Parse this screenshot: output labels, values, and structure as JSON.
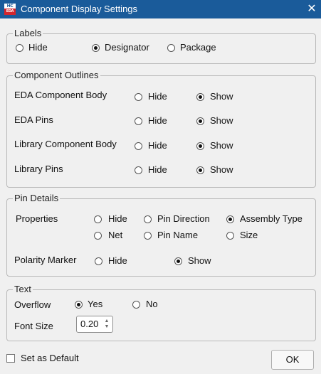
{
  "window": {
    "title": "Component Display Settings",
    "icon_top": "HC",
    "icon_bottom": "EDA",
    "close_glyph": "✕"
  },
  "labels": {
    "legend": "Labels",
    "options": [
      "Hide",
      "Designator",
      "Package"
    ],
    "selected": "Designator"
  },
  "outlines": {
    "legend": "Component Outlines",
    "rows": [
      {
        "label": "EDA Component Body",
        "hide": "Hide",
        "show": "Show",
        "selected": "Show"
      },
      {
        "label": "EDA Pins",
        "hide": "Hide",
        "show": "Show",
        "selected": "Show"
      },
      {
        "label": "Library Component Body",
        "hide": "Hide",
        "show": "Show",
        "selected": "Show"
      },
      {
        "label": "Library Pins",
        "hide": "Hide",
        "show": "Show",
        "selected": "Show"
      }
    ]
  },
  "pin_details": {
    "legend": "Pin Details",
    "properties_label": "Properties",
    "properties_options": [
      "Hide",
      "Pin Direction",
      "Assembly Type",
      "Net",
      "Pin Name",
      "Size"
    ],
    "properties_selected": "Assembly Type",
    "polarity_label": "Polarity Marker",
    "polarity_options": [
      "Hide",
      "Show"
    ],
    "polarity_selected": "Show"
  },
  "text": {
    "legend": "Text",
    "overflow_label": "Overflow",
    "overflow_options": [
      "Yes",
      "No"
    ],
    "overflow_selected": "Yes",
    "font_size_label": "Font Size",
    "font_size_value": "0.20"
  },
  "footer": {
    "set_default_label": "Set as Default",
    "set_default_checked": false,
    "ok_label": "OK"
  },
  "icons": [
    "app-logo-icon",
    "close-icon",
    "spin-up-icon",
    "spin-down-icon"
  ]
}
